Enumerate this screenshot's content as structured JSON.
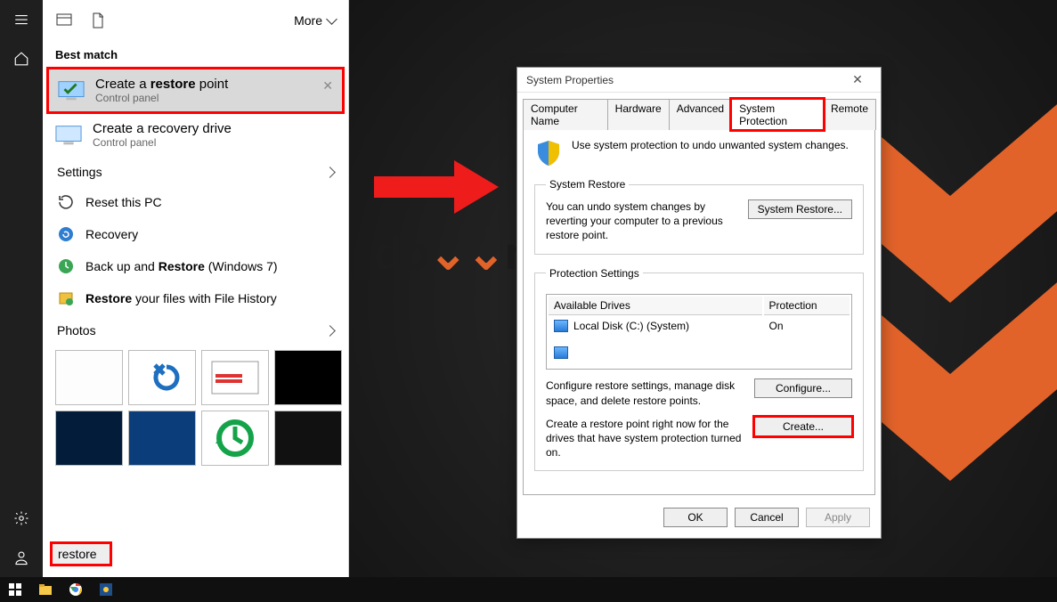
{
  "start_panel": {
    "more_label": "More",
    "sections": {
      "best_match": "Best match",
      "settings": "Settings",
      "photos": "Photos"
    },
    "results": [
      {
        "title_pre": "Create a ",
        "title_bold": "restore",
        "title_post": " point",
        "subtitle": "Control panel"
      },
      {
        "title_pre": "Create a recovery drive",
        "title_bold": "",
        "title_post": "",
        "subtitle": "Control panel"
      }
    ],
    "settings_items": [
      {
        "label_pre": "Reset this PC",
        "label_bold": "",
        "label_post": ""
      },
      {
        "label_pre": "Recovery",
        "label_bold": "",
        "label_post": ""
      },
      {
        "label_pre": "Back up and ",
        "label_bold": "Restore",
        "label_post": " (Windows 7)"
      },
      {
        "label_pre": "",
        "label_bold": "Restore",
        "label_post": " your files with File History"
      }
    ],
    "search_value": "restore"
  },
  "dialog": {
    "title": "System Properties",
    "tabs": [
      "Computer Name",
      "Hardware",
      "Advanced",
      "System Protection",
      "Remote"
    ],
    "intro": "Use system protection to undo unwanted system changes.",
    "restore_group": {
      "legend": "System Restore",
      "text": "You can undo system changes by reverting your computer to a previous restore point.",
      "button": "System Restore..."
    },
    "protection_group": {
      "legend": "Protection Settings",
      "col_drive": "Available Drives",
      "col_prot": "Protection",
      "drive": "Local Disk (C:) (System)",
      "drive_status": "On",
      "configure_text": "Configure restore settings, manage disk space, and delete restore points.",
      "configure_btn": "Configure...",
      "create_text": "Create a restore point right now for the drives that have system protection turned on.",
      "create_btn": "Create..."
    },
    "footer": {
      "ok": "OK",
      "cancel": "Cancel",
      "apply": "Apply"
    }
  },
  "wallpaper_text": {
    "pre": "do",
    "mid": "v",
    "post": "nlo"
  }
}
